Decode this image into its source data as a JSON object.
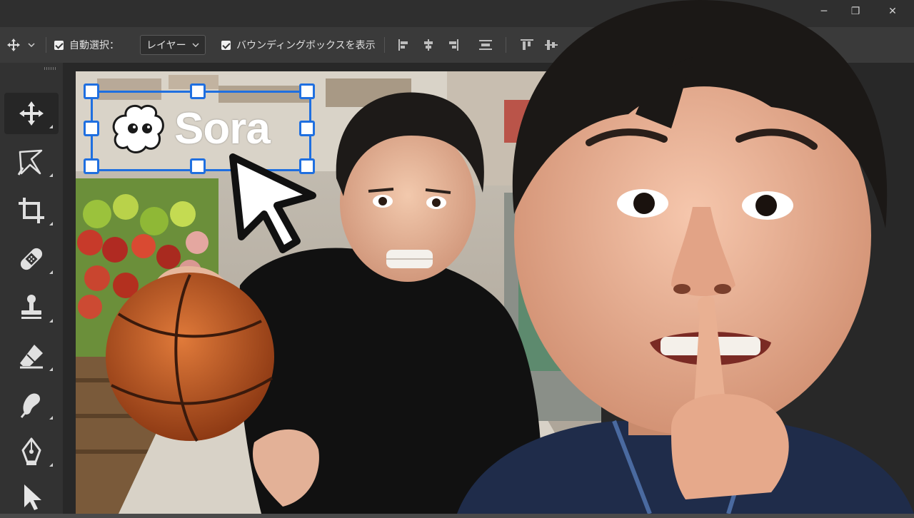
{
  "window": {
    "minimize_glyph": "─",
    "restore_glyph": "❐",
    "close_glyph": "✕"
  },
  "options_bar": {
    "auto_select_label": "自動選択：",
    "auto_select_value": "レイヤー",
    "show_bounding_box_label": "バウンディングボックスを表示"
  },
  "tools": [
    {
      "name": "move-tool",
      "icon": "move-icon",
      "active": true
    },
    {
      "name": "lasso-tool",
      "icon": "lasso-icon"
    },
    {
      "name": "crop-tool",
      "icon": "crop-icon"
    },
    {
      "name": "healing-tool",
      "icon": "bandage-icon"
    },
    {
      "name": "stamp-tool",
      "icon": "stamp-icon"
    },
    {
      "name": "eraser-tool",
      "icon": "eraser-icon"
    },
    {
      "name": "smudge-tool",
      "icon": "smudge-icon"
    },
    {
      "name": "pen-tool",
      "icon": "pen-icon"
    },
    {
      "name": "selection-tool",
      "icon": "arrow-icon"
    }
  ],
  "canvas": {
    "logo_text": "Sora",
    "selection_color": "#1f6fe0"
  }
}
